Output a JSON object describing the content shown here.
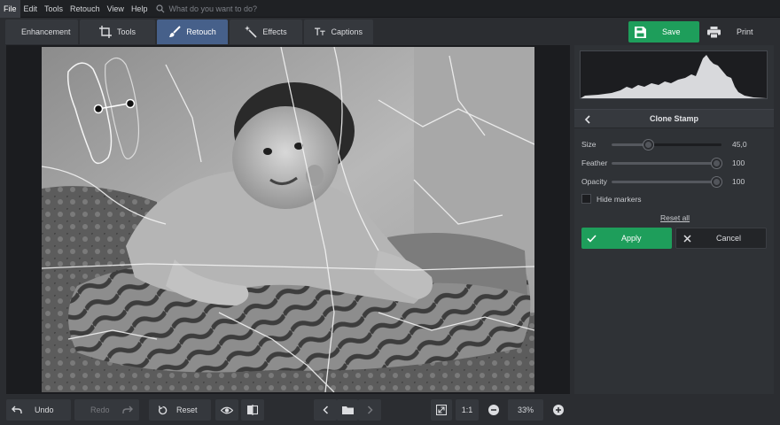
{
  "menubar": {
    "items": [
      "File",
      "Edit",
      "Tools",
      "Retouch",
      "View",
      "Help"
    ],
    "active": "File",
    "search_placeholder": "What do you want to do?"
  },
  "toolbar": {
    "tabs": [
      {
        "label": "Enhancement",
        "icon": "sliders-icon"
      },
      {
        "label": "Tools",
        "icon": "crop-icon"
      },
      {
        "label": "Retouch",
        "icon": "brush-icon"
      },
      {
        "label": "Effects",
        "icon": "magic-wand-icon"
      },
      {
        "label": "Captions",
        "icon": "text-icon"
      }
    ],
    "active_tab": "Retouch",
    "save_label": "Save",
    "print_label": "Print"
  },
  "panel": {
    "title": "Clone Stamp",
    "sliders": [
      {
        "label": "Size",
        "value": "45,0",
        "level": 0.32
      },
      {
        "label": "Feather",
        "value": "100",
        "level": 1.0
      },
      {
        "label": "Opacity",
        "value": "100",
        "level": 1.0
      }
    ],
    "hide_markers_label": "Hide markers",
    "hide_markers_checked": false,
    "reset_all_label": "Reset all",
    "apply_label": "Apply",
    "cancel_label": "Cancel"
  },
  "bottombar": {
    "undo_label": "Undo",
    "redo_label": "Redo",
    "reset_label": "Reset",
    "actual_size_label": "1:1",
    "zoom": "33%"
  },
  "colors": {
    "accent_green": "#1e9e5b",
    "active_tab": "#46608a",
    "background": "#2b2d31"
  }
}
